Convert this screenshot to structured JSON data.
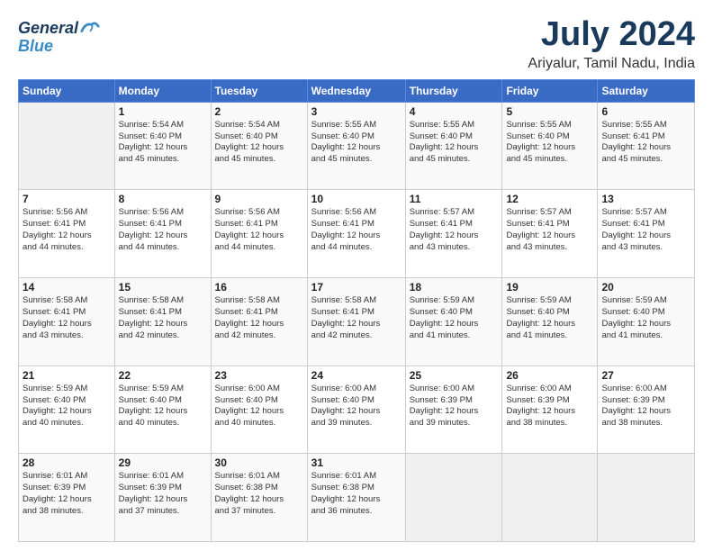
{
  "header": {
    "logo_line1": "General",
    "logo_line2": "Blue",
    "title": "July 2024",
    "subtitle": "Ariyalur, Tamil Nadu, India"
  },
  "calendar": {
    "days_of_week": [
      "Sunday",
      "Monday",
      "Tuesday",
      "Wednesday",
      "Thursday",
      "Friday",
      "Saturday"
    ],
    "weeks": [
      [
        {
          "day": "",
          "info": ""
        },
        {
          "day": "1",
          "info": "Sunrise: 5:54 AM\nSunset: 6:40 PM\nDaylight: 12 hours\nand 45 minutes."
        },
        {
          "day": "2",
          "info": "Sunrise: 5:54 AM\nSunset: 6:40 PM\nDaylight: 12 hours\nand 45 minutes."
        },
        {
          "day": "3",
          "info": "Sunrise: 5:55 AM\nSunset: 6:40 PM\nDaylight: 12 hours\nand 45 minutes."
        },
        {
          "day": "4",
          "info": "Sunrise: 5:55 AM\nSunset: 6:40 PM\nDaylight: 12 hours\nand 45 minutes."
        },
        {
          "day": "5",
          "info": "Sunrise: 5:55 AM\nSunset: 6:40 PM\nDaylight: 12 hours\nand 45 minutes."
        },
        {
          "day": "6",
          "info": "Sunrise: 5:55 AM\nSunset: 6:41 PM\nDaylight: 12 hours\nand 45 minutes."
        }
      ],
      [
        {
          "day": "7",
          "info": "Sunrise: 5:56 AM\nSunset: 6:41 PM\nDaylight: 12 hours\nand 44 minutes."
        },
        {
          "day": "8",
          "info": "Sunrise: 5:56 AM\nSunset: 6:41 PM\nDaylight: 12 hours\nand 44 minutes."
        },
        {
          "day": "9",
          "info": "Sunrise: 5:56 AM\nSunset: 6:41 PM\nDaylight: 12 hours\nand 44 minutes."
        },
        {
          "day": "10",
          "info": "Sunrise: 5:56 AM\nSunset: 6:41 PM\nDaylight: 12 hours\nand 44 minutes."
        },
        {
          "day": "11",
          "info": "Sunrise: 5:57 AM\nSunset: 6:41 PM\nDaylight: 12 hours\nand 43 minutes."
        },
        {
          "day": "12",
          "info": "Sunrise: 5:57 AM\nSunset: 6:41 PM\nDaylight: 12 hours\nand 43 minutes."
        },
        {
          "day": "13",
          "info": "Sunrise: 5:57 AM\nSunset: 6:41 PM\nDaylight: 12 hours\nand 43 minutes."
        }
      ],
      [
        {
          "day": "14",
          "info": "Sunrise: 5:58 AM\nSunset: 6:41 PM\nDaylight: 12 hours\nand 43 minutes."
        },
        {
          "day": "15",
          "info": "Sunrise: 5:58 AM\nSunset: 6:41 PM\nDaylight: 12 hours\nand 42 minutes."
        },
        {
          "day": "16",
          "info": "Sunrise: 5:58 AM\nSunset: 6:41 PM\nDaylight: 12 hours\nand 42 minutes."
        },
        {
          "day": "17",
          "info": "Sunrise: 5:58 AM\nSunset: 6:41 PM\nDaylight: 12 hours\nand 42 minutes."
        },
        {
          "day": "18",
          "info": "Sunrise: 5:59 AM\nSunset: 6:40 PM\nDaylight: 12 hours\nand 41 minutes."
        },
        {
          "day": "19",
          "info": "Sunrise: 5:59 AM\nSunset: 6:40 PM\nDaylight: 12 hours\nand 41 minutes."
        },
        {
          "day": "20",
          "info": "Sunrise: 5:59 AM\nSunset: 6:40 PM\nDaylight: 12 hours\nand 41 minutes."
        }
      ],
      [
        {
          "day": "21",
          "info": "Sunrise: 5:59 AM\nSunset: 6:40 PM\nDaylight: 12 hours\nand 40 minutes."
        },
        {
          "day": "22",
          "info": "Sunrise: 5:59 AM\nSunset: 6:40 PM\nDaylight: 12 hours\nand 40 minutes."
        },
        {
          "day": "23",
          "info": "Sunrise: 6:00 AM\nSunset: 6:40 PM\nDaylight: 12 hours\nand 40 minutes."
        },
        {
          "day": "24",
          "info": "Sunrise: 6:00 AM\nSunset: 6:40 PM\nDaylight: 12 hours\nand 39 minutes."
        },
        {
          "day": "25",
          "info": "Sunrise: 6:00 AM\nSunset: 6:39 PM\nDaylight: 12 hours\nand 39 minutes."
        },
        {
          "day": "26",
          "info": "Sunrise: 6:00 AM\nSunset: 6:39 PM\nDaylight: 12 hours\nand 38 minutes."
        },
        {
          "day": "27",
          "info": "Sunrise: 6:00 AM\nSunset: 6:39 PM\nDaylight: 12 hours\nand 38 minutes."
        }
      ],
      [
        {
          "day": "28",
          "info": "Sunrise: 6:01 AM\nSunset: 6:39 PM\nDaylight: 12 hours\nand 38 minutes."
        },
        {
          "day": "29",
          "info": "Sunrise: 6:01 AM\nSunset: 6:39 PM\nDaylight: 12 hours\nand 37 minutes."
        },
        {
          "day": "30",
          "info": "Sunrise: 6:01 AM\nSunset: 6:38 PM\nDaylight: 12 hours\nand 37 minutes."
        },
        {
          "day": "31",
          "info": "Sunrise: 6:01 AM\nSunset: 6:38 PM\nDaylight: 12 hours\nand 36 minutes."
        },
        {
          "day": "",
          "info": ""
        },
        {
          "day": "",
          "info": ""
        },
        {
          "day": "",
          "info": ""
        }
      ]
    ]
  }
}
